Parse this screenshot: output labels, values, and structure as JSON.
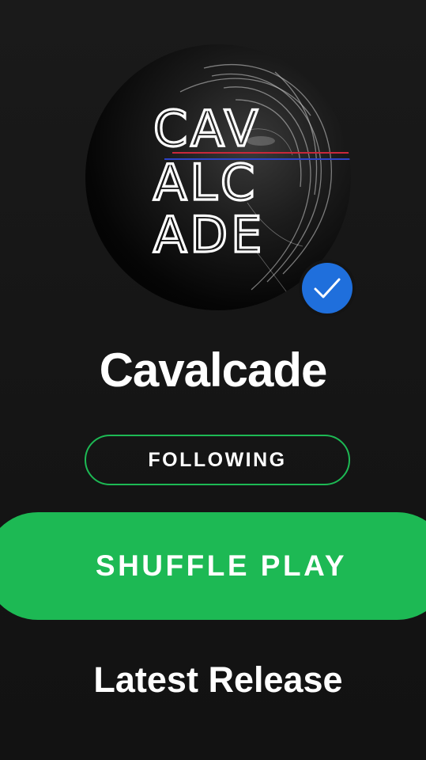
{
  "artist": {
    "name": "Cavalcade",
    "avatar_logo_lines": [
      "CAV",
      "ALC",
      "ADE"
    ],
    "verified": true
  },
  "actions": {
    "follow_label": "FOLLOWING",
    "shuffle_label": "SHUFFLE PLAY"
  },
  "sections": {
    "latest_release_title": "Latest Release"
  },
  "icons": {
    "verified": "check-icon"
  },
  "colors": {
    "background": "#121212",
    "accent_green": "#1db954",
    "verified_blue": "#1f6fdc",
    "text": "#ffffff"
  }
}
